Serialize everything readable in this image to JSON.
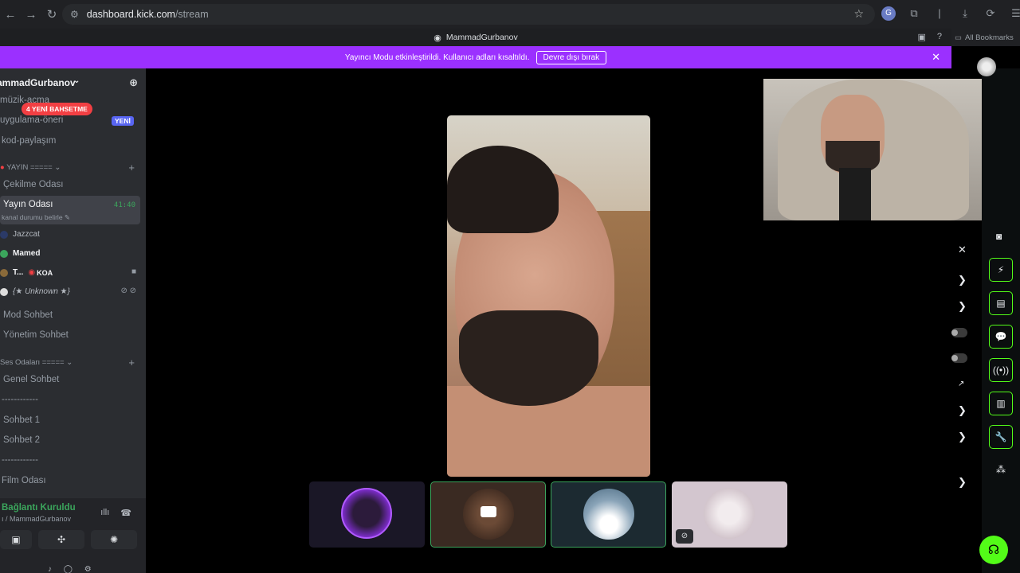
{
  "browser": {
    "url_host": "dashboard.kick.com",
    "url_path": "/stream",
    "bookmarks_label": "All Bookmarks"
  },
  "discord": {
    "window_title": "MammadGurbanov",
    "notice": {
      "text": "Yayıncı Modu etkinleştirildi. Kullanıcı adları kısaltıldı.",
      "button": "Devre dışı bırak"
    },
    "server_name": "ammadGurbanov",
    "mention_pill": "4 YENİ BAHSETME",
    "new_pill": "YENİ",
    "channels": {
      "muzik": "müzik-acma",
      "uygulama": "uygulama-öneri",
      "kod": "kod-paylaşım",
      "yayin_category": "YAYIN =====",
      "cekilme": "Çekilme Odası",
      "yayin_odasi": "Yayın Odası",
      "yayin_time": "41:40",
      "yayin_status": "kanal durumu belirle",
      "mod": "Mod Sohbet",
      "yonetim": "Yönetim Sohbet",
      "ses_category": "Ses Odaları =====",
      "genel": "Genel Sohbet",
      "divider1": "------------",
      "sohbet1": "Sohbet 1",
      "sohbet2": "Sohbet 2",
      "divider2": "------------",
      "film": "Film Odası"
    },
    "voice_users": [
      {
        "name": "Jazzcat"
      },
      {
        "name": "Mamed"
      },
      {
        "name": "T...",
        "tag": "KOA"
      },
      {
        "name": "{★ Unknown ★}"
      }
    ],
    "voice_panel": {
      "status": "Bağlantı Kuruldu",
      "sub": "ı / MammadGurbanov"
    }
  }
}
